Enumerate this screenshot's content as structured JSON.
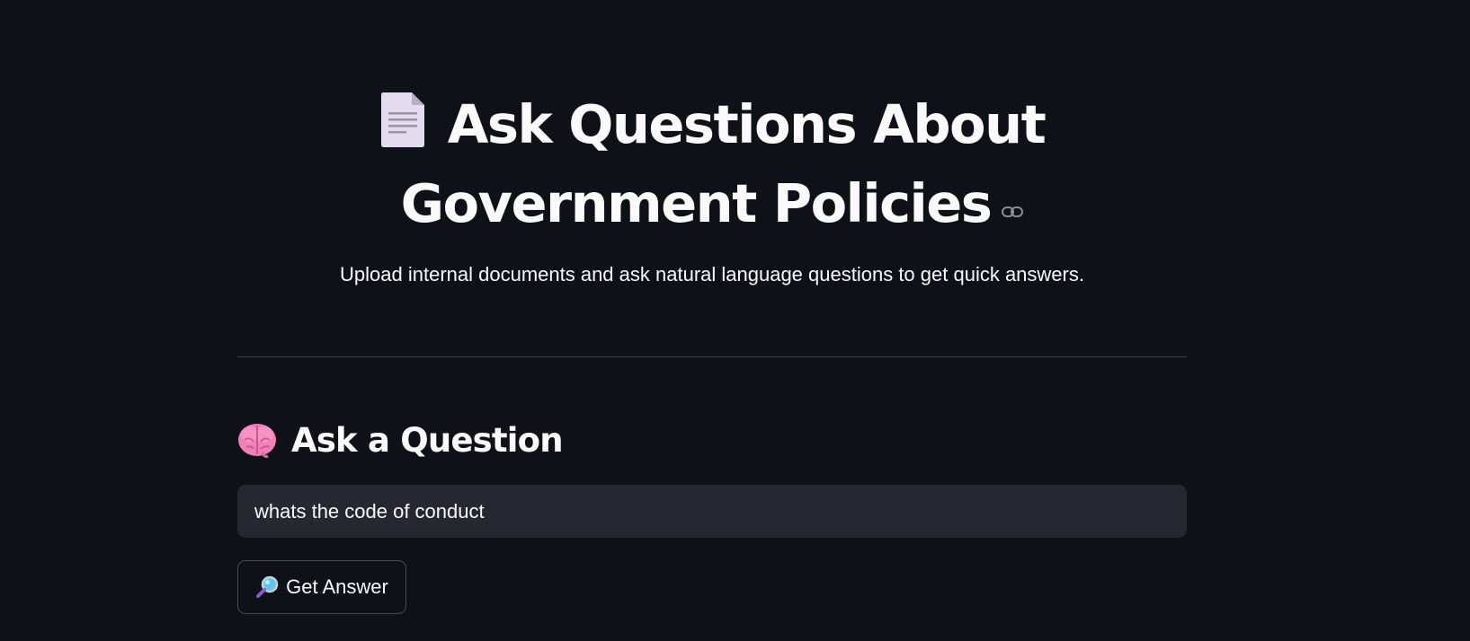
{
  "header": {
    "title_line1": "Ask Questions About",
    "title_line2": "Government Policies",
    "title_icon": "page-document-icon",
    "anchor_icon": "link-icon",
    "subtitle": "Upload internal documents and ask natural language questions to get quick answers."
  },
  "ask_section": {
    "icon": "brain-icon",
    "heading": "Ask a Question",
    "question_value": "whats the code of conduct",
    "button_icon": "magnifier-icon",
    "button_label": "Get Answer"
  },
  "colors": {
    "background": "#0e1117",
    "text": "#fafafa",
    "input_background": "#262730",
    "divider": "#3a3d46",
    "button_border": "#474a55"
  }
}
